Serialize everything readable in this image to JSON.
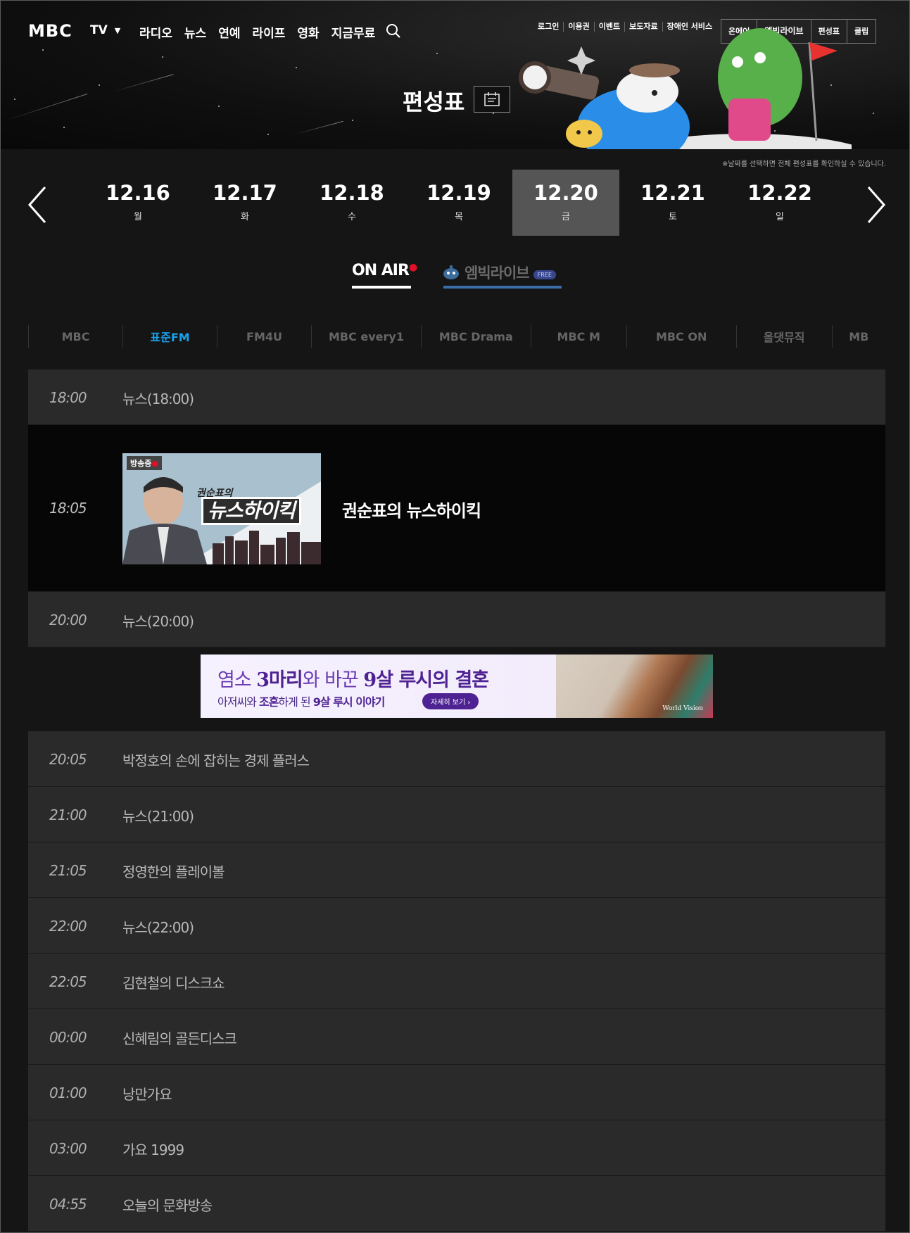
{
  "header": {
    "logo": "MBC",
    "tv_label": "TV",
    "gnb": [
      "라디오",
      "뉴스",
      "연예",
      "라이프",
      "영화",
      "지금무료"
    ],
    "util_links": [
      "로그인",
      "이용권",
      "이벤트",
      "보도자료",
      "장애인 서비스"
    ],
    "util_box": [
      "온에어",
      "엠빅라이브",
      "편성표",
      "클립"
    ],
    "page_title": "편성표"
  },
  "date_note": "※날짜를 선택하면 전체 편성표를 확인하실 수 있습니다.",
  "dates": [
    {
      "d": "12.16",
      "w": "월"
    },
    {
      "d": "12.17",
      "w": "화"
    },
    {
      "d": "12.18",
      "w": "수"
    },
    {
      "d": "12.19",
      "w": "목"
    },
    {
      "d": "12.20",
      "w": "금",
      "active": true
    },
    {
      "d": "12.21",
      "w": "토"
    },
    {
      "d": "12.22",
      "w": "일"
    }
  ],
  "tabs": {
    "onair": "ON AIR",
    "mbic": "엠빅라이브",
    "free": "FREE"
  },
  "channels": [
    "MBC",
    "표준FM",
    "FM4U",
    "MBC every1",
    "MBC Drama",
    "MBC M",
    "MBC ON",
    "올댓뮤직",
    "MB"
  ],
  "schedule": [
    {
      "time": "18:00",
      "title": "뉴스(18:00)"
    },
    {
      "time": "18:05",
      "title": "권순표의 뉴스하이킥",
      "live": true,
      "badge": "방송중",
      "thumb_small": "권순표의",
      "thumb_title": "뉴스하이킥"
    },
    {
      "time": "20:00",
      "title": "뉴스(20:00)"
    },
    {
      "time": "20:05",
      "title": "박정호의 손에 잡히는 경제 플러스"
    },
    {
      "time": "21:00",
      "title": "뉴스(21:00)"
    },
    {
      "time": "21:05",
      "title": "정영한의 플레이볼"
    },
    {
      "time": "22:00",
      "title": "뉴스(22:00)"
    },
    {
      "time": "22:05",
      "title": "김현철의 디스크쇼"
    },
    {
      "time": "00:00",
      "title": "신혜림의 골든디스크"
    },
    {
      "time": "01:00",
      "title": "낭만가요"
    },
    {
      "time": "03:00",
      "title": "가요 1999"
    },
    {
      "time": "04:55",
      "title": "오늘의 문화방송"
    }
  ],
  "ad": {
    "line1_a": "염소 ",
    "line1_b": "3마리",
    "line1_c": "와 바꾼 ",
    "line1_d": "9살 루시의 결혼",
    "line2_a": "아저씨와 ",
    "line2_b": "조혼",
    "line2_c": "하게 된 ",
    "line2_d": "9살 루시 이야기",
    "more": "자세히 보기  ›",
    "brand": "World Vision"
  }
}
